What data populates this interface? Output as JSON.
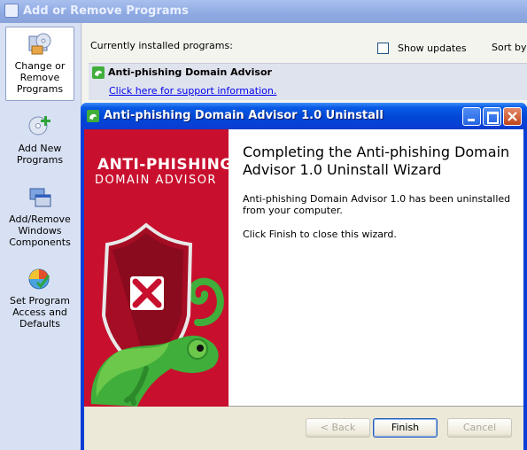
{
  "back_window": {
    "title": "Add or Remove Programs",
    "sidebar": [
      {
        "label": "Change or Remove Programs",
        "selected": true,
        "icon": "change-remove-programs-icon"
      },
      {
        "label": "Add New Programs",
        "selected": false,
        "icon": "add-new-programs-icon"
      },
      {
        "label": "Add/Remove Windows Components",
        "selected": false,
        "icon": "windows-components-icon"
      },
      {
        "label": "Set Program Access and Defaults",
        "selected": false,
        "icon": "program-access-icon"
      }
    ],
    "installed_label": "Currently installed programs:",
    "show_updates_label": "Show updates",
    "show_updates_checked": false,
    "sort_by_label": "Sort by:",
    "program": {
      "name": "Anti-phishing Domain Advisor",
      "support_link": "Click here for support information."
    }
  },
  "wizard": {
    "title": "Anti-phishing Domain Advisor 1.0 Uninstall",
    "banner": {
      "line1": "ANTI-PHISHING",
      "line2": "DOMAIN ADVISOR",
      "color": "#c8102e"
    },
    "heading": "Completing the Anti-phishing Domain Advisor 1.0 Uninstall Wizard",
    "description": "Anti-phishing Domain Advisor 1.0 has been uninstalled from your computer.",
    "finish_note": "Click Finish to close this wizard.",
    "buttons": {
      "back": "< Back",
      "finish": "Finish",
      "cancel": "Cancel"
    },
    "title_colors": {
      "titlebar": "#0a3ed6",
      "close": "#c1441b"
    }
  }
}
